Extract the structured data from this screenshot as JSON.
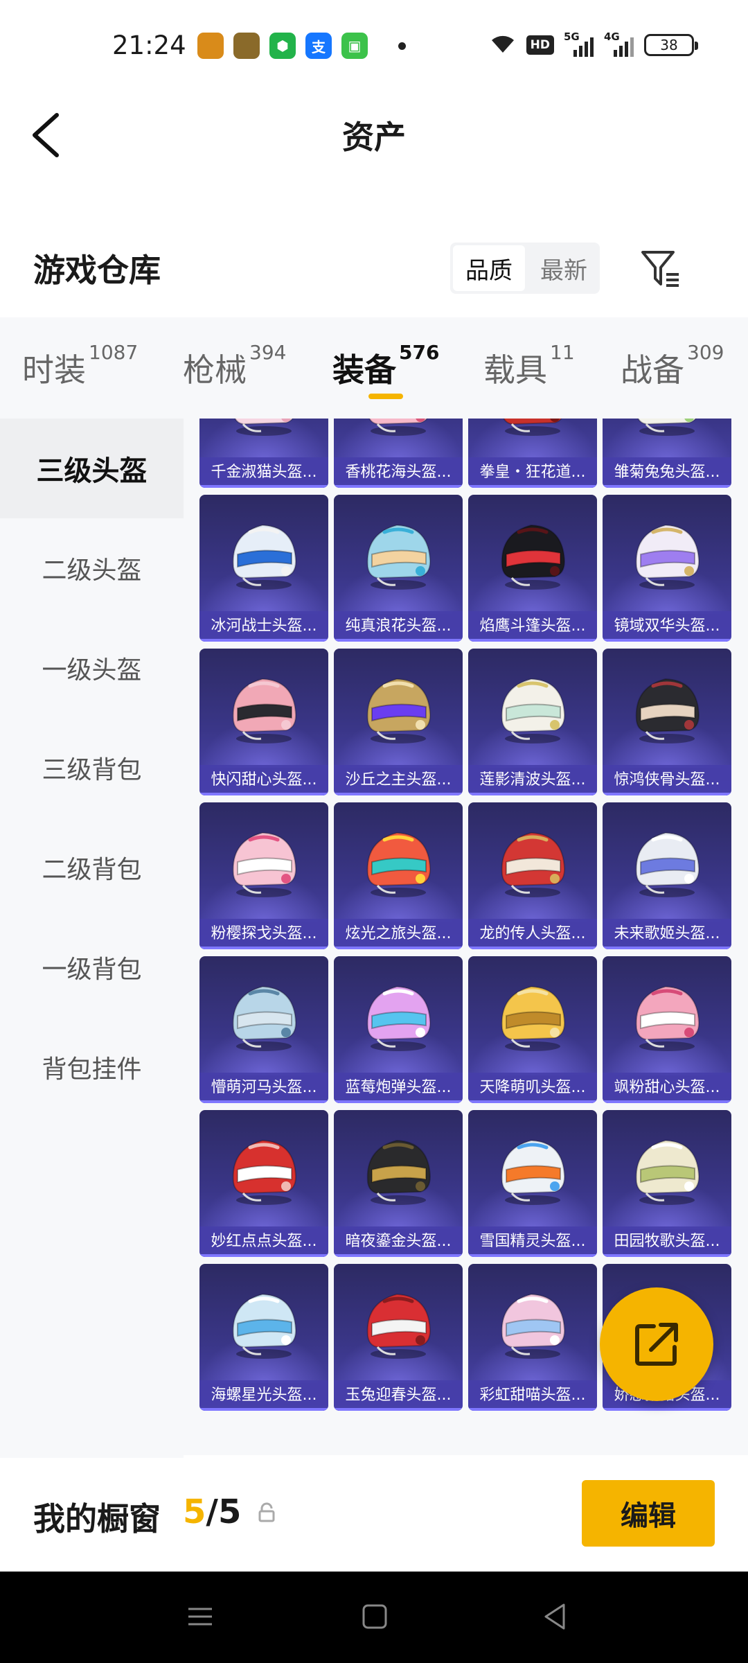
{
  "status": {
    "time": "21:24",
    "apps": [
      {
        "icon": "game-app-icon",
        "color": "#d98b1a"
      },
      {
        "icon": "pubg-app-icon",
        "color": "#8a6a2a"
      },
      {
        "icon": "shield-app-icon",
        "color": "#22b34a",
        "glyph": "⬢"
      },
      {
        "icon": "alipay-app-icon",
        "color": "#1677ff",
        "glyph": "支"
      },
      {
        "icon": "message-app-icon",
        "color": "#3cc24a",
        "glyph": "▣"
      }
    ],
    "hd": "HD",
    "sig1": "5G",
    "sig2": "4G",
    "battery": "38"
  },
  "header": {
    "title": "资产"
  },
  "warehouse": {
    "title": "游戏仓库",
    "sort_options": [
      "品质",
      "最新"
    ]
  },
  "tabs": [
    {
      "label": "时装",
      "count": "1087",
      "active": false
    },
    {
      "label": "枪械",
      "count": "394",
      "active": false
    },
    {
      "label": "装备",
      "count": "576",
      "active": true
    },
    {
      "label": "载具",
      "count": "11",
      "active": false
    },
    {
      "label": "战备",
      "count": "309",
      "active": false
    }
  ],
  "sidebar": [
    {
      "label": "三级头盔",
      "active": true
    },
    {
      "label": "二级头盔",
      "active": false
    },
    {
      "label": "一级头盔",
      "active": false
    },
    {
      "label": "三级背包",
      "active": false
    },
    {
      "label": "二级背包",
      "active": false
    },
    {
      "label": "一级背包",
      "active": false
    },
    {
      "label": "背包挂件",
      "active": false
    }
  ],
  "items": [
    {
      "name": "千金淑猫头盔...",
      "colors": [
        "#f6d6e2",
        "#ffffff",
        "#e8a2b8"
      ]
    },
    {
      "name": "香桃花海头盔...",
      "colors": [
        "#f7b9c9",
        "#f1e7ee",
        "#d9577a"
      ]
    },
    {
      "name": "拳皇・狂花道...",
      "colors": [
        "#c8312b",
        "#f0c64a",
        "#7a1616"
      ]
    },
    {
      "name": "雏菊兔兔头盔...",
      "colors": [
        "#f2f2ea",
        "#c4e9a8",
        "#9dd07a"
      ]
    },
    {
      "name": "冰河战士头盔...",
      "colors": [
        "#e6eef8",
        "#2a6fd8",
        "#f3f3f3"
      ]
    },
    {
      "name": "纯真浪花头盔...",
      "colors": [
        "#9ed6ea",
        "#f3d3a0",
        "#39b0d8"
      ]
    },
    {
      "name": "焰鹰斗篷头盔...",
      "colors": [
        "#1a1a1f",
        "#e0343a",
        "#571418"
      ]
    },
    {
      "name": "镜域双华头盔...",
      "colors": [
        "#f1ecf7",
        "#9e7ef0",
        "#d4b56a"
      ]
    },
    {
      "name": "快闪甜心头盔...",
      "colors": [
        "#f1a8b6",
        "#2a2a30",
        "#f5c8d2"
      ]
    },
    {
      "name": "沙丘之主头盔...",
      "colors": [
        "#c7a660",
        "#6a3ef0",
        "#f1dfae"
      ]
    },
    {
      "name": "莲影清波头盔...",
      "colors": [
        "#f3f1e9",
        "#c9e7d9",
        "#d8c46d"
      ]
    },
    {
      "name": "惊鸿侠骨头盔...",
      "colors": [
        "#2b2b30",
        "#e6d3c0",
        "#a0363a"
      ]
    },
    {
      "name": "粉樱探戈头盔...",
      "colors": [
        "#f7c4d3",
        "#ffffff",
        "#e35583"
      ]
    },
    {
      "name": "炫光之旅头盔...",
      "colors": [
        "#f15a3f",
        "#36c9c5",
        "#ffd23b"
      ]
    },
    {
      "name": "龙的传人头盔...",
      "colors": [
        "#d33734",
        "#f2e7da",
        "#d8ad5b"
      ]
    },
    {
      "name": "未来歌姬头盔...",
      "colors": [
        "#e9ecf3",
        "#6d7be0",
        "#ffffff"
      ]
    },
    {
      "name": "懵萌河马头盔...",
      "colors": [
        "#b8d6e8",
        "#d8e6ef",
        "#5a86a6"
      ]
    },
    {
      "name": "蓝莓炮弹头盔...",
      "colors": [
        "#e3a3f0",
        "#56c4ef",
        "#ffffff"
      ]
    },
    {
      "name": "天降萌叽头盔...",
      "colors": [
        "#f4c54b",
        "#c08b2a",
        "#f5e2a2"
      ]
    },
    {
      "name": "飒粉甜心头盔...",
      "colors": [
        "#f3a6bd",
        "#ffffff",
        "#d74b78"
      ]
    },
    {
      "name": "妙红点点头盔...",
      "colors": [
        "#d7312e",
        "#ffffff",
        "#f0b9b3"
      ]
    },
    {
      "name": "暗夜鎏金头盔...",
      "colors": [
        "#2a2a2c",
        "#c8a24a",
        "#6a5a32"
      ]
    },
    {
      "name": "雪国精灵头盔...",
      "colors": [
        "#eef2f6",
        "#f57a2a",
        "#4ba4ef"
      ]
    },
    {
      "name": "田园牧歌头盔...",
      "colors": [
        "#eee9cf",
        "#b9c777",
        "#ffffff"
      ]
    },
    {
      "name": "海螺星光头盔...",
      "colors": [
        "#cfe7f5",
        "#5cb4ea",
        "#ffffff"
      ]
    },
    {
      "name": "玉兔迎春头盔...",
      "colors": [
        "#d92f33",
        "#f4f4f4",
        "#8a1c1e"
      ]
    },
    {
      "name": "彩虹甜喵头盔...",
      "colors": [
        "#f1c6de",
        "#9fc6f3",
        "#ffffff"
      ]
    },
    {
      "name": "娇憨猪猪头盔...",
      "colors": [
        "#f5b7c6",
        "#ffffff",
        "#e06a8d"
      ]
    }
  ],
  "showcase": {
    "title": "我的橱窗",
    "current": "5",
    "separator": "/",
    "total": "5",
    "edit_label": "编辑"
  },
  "theme": {
    "accent": "#f5b400",
    "card_bg": "#3a3688"
  }
}
